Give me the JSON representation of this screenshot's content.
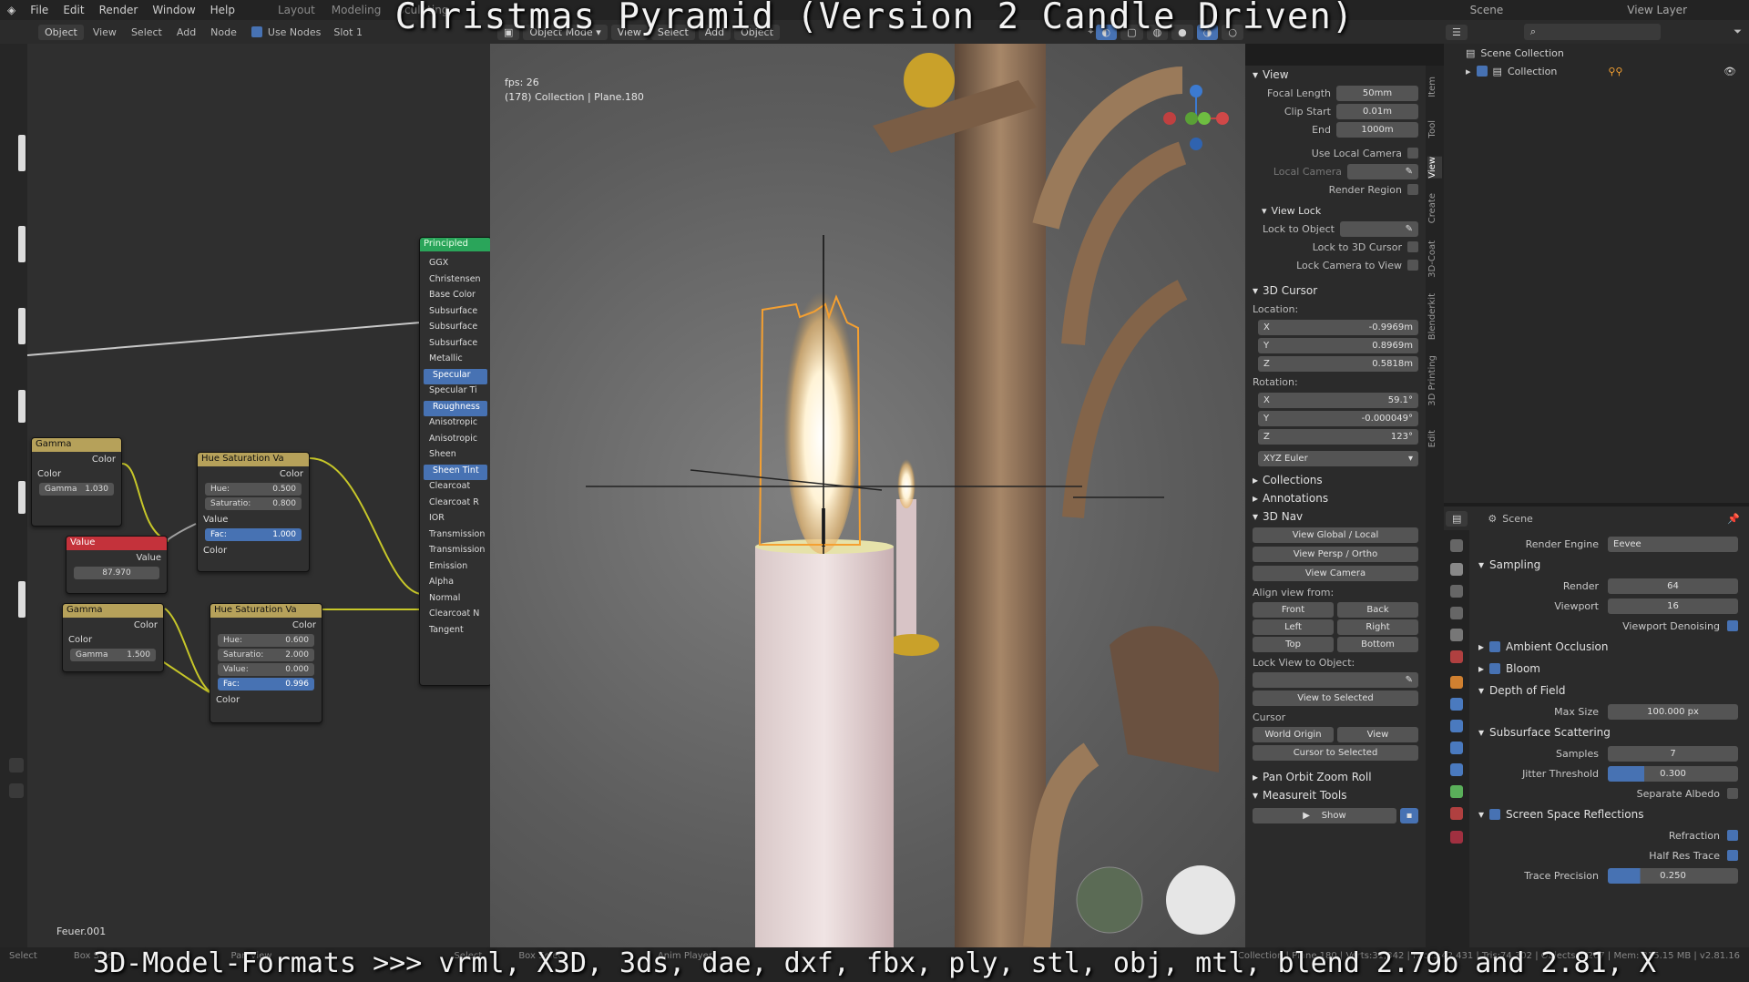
{
  "video": {
    "title": "Christmas Pyramid (Version 2 Candle Driven)",
    "caption": "3D-Model-Formats >>> vrml, X3D, 3ds, dae, dxf, fbx, ply, stl, obj, mtl, blend 2.79b and 2.81, X"
  },
  "topbar": {
    "menus": [
      "File",
      "Edit",
      "Render",
      "Window",
      "Help"
    ],
    "workspaces": [
      "Layout",
      "Modeling",
      "Sculpting"
    ],
    "scene": "Scene",
    "view_layer": "View Layer"
  },
  "node_editor": {
    "header": {
      "object": "Object",
      "view": "View",
      "select": "Select",
      "add": "Add",
      "node": "Node",
      "use_nodes": "Use Nodes",
      "slot": "Slot 1"
    },
    "material_label": "Feuer.001",
    "principled": {
      "title": "Principled",
      "inputs": [
        "GGX",
        "Christensen",
        "Base Color",
        "Subsurface",
        "Subsurface",
        "Subsurface",
        "Metallic",
        "Specular",
        "Specular Ti",
        "Roughness",
        "Anisotropic",
        "Anisotropic",
        "Sheen",
        "Sheen Tint",
        "Clearcoat",
        "Clearcoat R",
        "IOR",
        "Transmission",
        "Transmission",
        "Emission",
        "Alpha",
        "Normal",
        "Clearcoat N",
        "Tangent"
      ]
    },
    "gamma1": {
      "title": "Gamma",
      "out": "Color",
      "in": "Color",
      "gamma_label": "Gamma",
      "gamma_value": "1.030"
    },
    "value_node": {
      "title": "Value",
      "out": "Value",
      "value": "87.970"
    },
    "gamma2": {
      "title": "Gamma",
      "out": "Color",
      "in": "Color",
      "gamma_label": "Gamma",
      "gamma_value": "1.500"
    },
    "hsv1": {
      "title": "Hue Saturation Va",
      "out": "Color",
      "hue": "0.500",
      "sat": "0.800",
      "val_label": "Value",
      "fac": "1.000",
      "color": "Color"
    },
    "hsv2": {
      "title": "Hue Saturation Va",
      "out": "Color",
      "hue": "0.600",
      "sat": "2.000",
      "val": "0.000",
      "fac": "0.996",
      "color": "Color"
    }
  },
  "viewport": {
    "header": {
      "mode": "Object Mode",
      "view": "View",
      "select": "Select",
      "add": "Add",
      "object": "Object"
    },
    "fps": "fps: 26",
    "info": "(178) Collection | Plane.180"
  },
  "npanel": {
    "view_section": "View",
    "focal_length_label": "Focal Length",
    "focal_length": "50mm",
    "clip_start_label": "Clip Start",
    "clip_start": "0.01m",
    "clip_end_label": "End",
    "clip_end": "1000m",
    "use_local_camera": "Use Local Camera",
    "local_camera": "Local Camera",
    "render_region": "Render Region",
    "view_lock": "View Lock",
    "lock_to_object": "Lock to Object",
    "lock_to_cursor": "Lock to 3D Cursor",
    "lock_camera": "Lock Camera to View",
    "cursor_section": "3D Cursor",
    "location_label": "Location:",
    "loc_x": "-0.9969m",
    "loc_y": "0.8969m",
    "loc_z": "0.5818m",
    "rotation_label": "Rotation:",
    "rot_x": "59.1°",
    "rot_y": "-0.000049°",
    "rot_z": "123°",
    "euler": "XYZ Euler",
    "collections": "Collections",
    "annotations": "Annotations",
    "nav_3d": "3D Nav",
    "view_global_local": "View Global / Local",
    "view_persp_ortho": "View Persp / Ortho",
    "view_camera": "View Camera",
    "align_view_from": "Align view from:",
    "front": "Front",
    "back": "Back",
    "left": "Left",
    "right": "Right",
    "top": "Top",
    "bottom": "Bottom",
    "lock_view_to_object": "Lock View to Object:",
    "view_to_selected": "View to Selected",
    "cursor": "Cursor",
    "world_origin": "World Origin",
    "view": "View",
    "cursor_to_selected": "Cursor to Selected",
    "pan_orbit": "Pan Orbit Zoom Roll",
    "measureit": "Measureit Tools",
    "show": "Show"
  },
  "ntabs": [
    "Item",
    "Tool",
    "View",
    "Create",
    "3D-Coat",
    "Blenderkit",
    "3D Printing",
    "Edit"
  ],
  "outliner": {
    "scene_collection": "Scene Collection",
    "collection": "Collection"
  },
  "properties": {
    "scene": "Scene",
    "render_engine_label": "Render Engine",
    "render_engine": "Eevee",
    "sampling": "Sampling",
    "render_label": "Render",
    "render_samples": "64",
    "viewport_label": "Viewport",
    "viewport_samples": "16",
    "viewport_denoising": "Viewport Denoising",
    "ambient_occlusion": "Ambient Occlusion",
    "bloom": "Bloom",
    "depth_of_field": "Depth of Field",
    "max_size_label": "Max Size",
    "max_size": "100.000 px",
    "sss": "Subsurface Scattering",
    "samples_label": "Samples",
    "samples": "7",
    "jitter_label": "Jitter Threshold",
    "jitter": "0.300",
    "separate_albedo": "Separate Albedo",
    "ssr": "Screen Space Reflections",
    "refraction": "Refraction",
    "half_res": "Half Res Trace",
    "trace_precision_label": "Trace Precision",
    "trace_precision": "0.250"
  },
  "statusbar": {
    "items": [
      "Select",
      "Box Select",
      "Pan View",
      "Select",
      "Box Select",
      "Anim Player"
    ],
    "stats": "Collection | Plane.180 | Verts:31,842 | Faces:42,431 | Tris:74,302 | Objects:1/267 | Mem: 315.15 MB | v2.81.16"
  },
  "colors": {
    "accent": "#4772b3",
    "selection": "#f5a031",
    "node_green": "#2aa55a",
    "node_yellow": "#b6a15a",
    "node_red": "#c4323b"
  }
}
